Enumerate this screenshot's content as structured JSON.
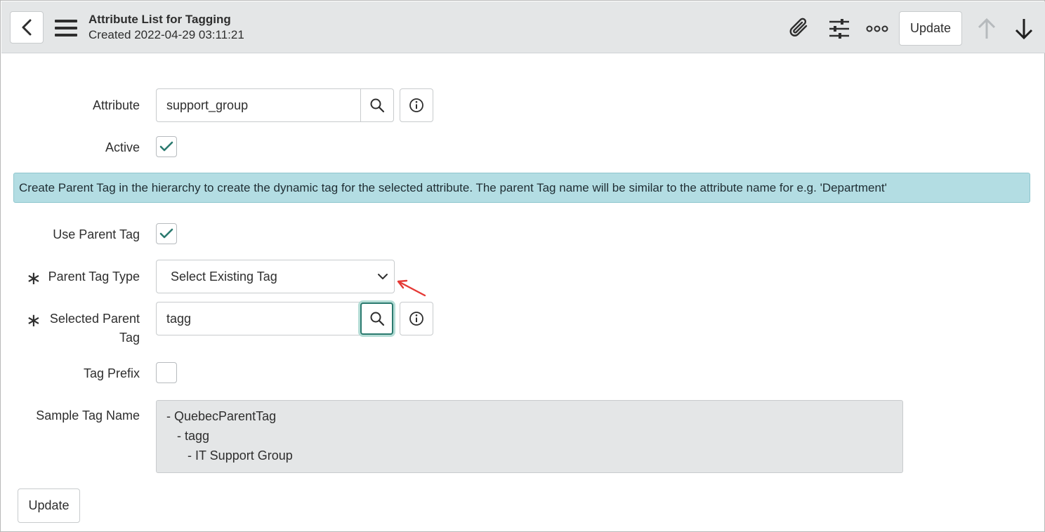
{
  "header": {
    "title": "Attribute List for Tagging",
    "subtitle": "Created 2022-04-29 03:11:21",
    "update_label": "Update",
    "icons": [
      "back-icon",
      "hamburger-menu-icon",
      "paperclip-icon",
      "sliders-icon",
      "more-icon",
      "arrow-up-icon",
      "arrow-down-icon"
    ]
  },
  "form": {
    "attribute": {
      "label": "Attribute",
      "value": "support_group"
    },
    "active": {
      "label": "Active",
      "checked": true
    },
    "banner": "Create Parent Tag in the hierarchy to create the dynamic tag for the selected attribute. The parent Tag name will be similar to the attribute name for e.g. 'Department'",
    "use_parent_tag": {
      "label": "Use Parent Tag",
      "checked": true
    },
    "parent_tag_type": {
      "label": "Parent Tag Type",
      "required_mark": "∗",
      "value": "Select Existing Tag"
    },
    "selected_parent_tag": {
      "label_line1": "Selected Parent",
      "label_line2": "Tag",
      "required_mark": "∗",
      "value": "tagg"
    },
    "tag_prefix": {
      "label": "Tag Prefix",
      "checked": false
    },
    "sample_tag_name": {
      "label": "Sample Tag Name",
      "lines": [
        "- QuebecParentTag",
        "   - tagg",
        "      - IT Support Group"
      ]
    }
  },
  "footer": {
    "update_label": "Update"
  },
  "colors": {
    "header_bg": "#e4e6e7",
    "banner_bg": "#b3dde3",
    "check": "#2b7a6f",
    "annotation_arrow": "#e53935"
  }
}
